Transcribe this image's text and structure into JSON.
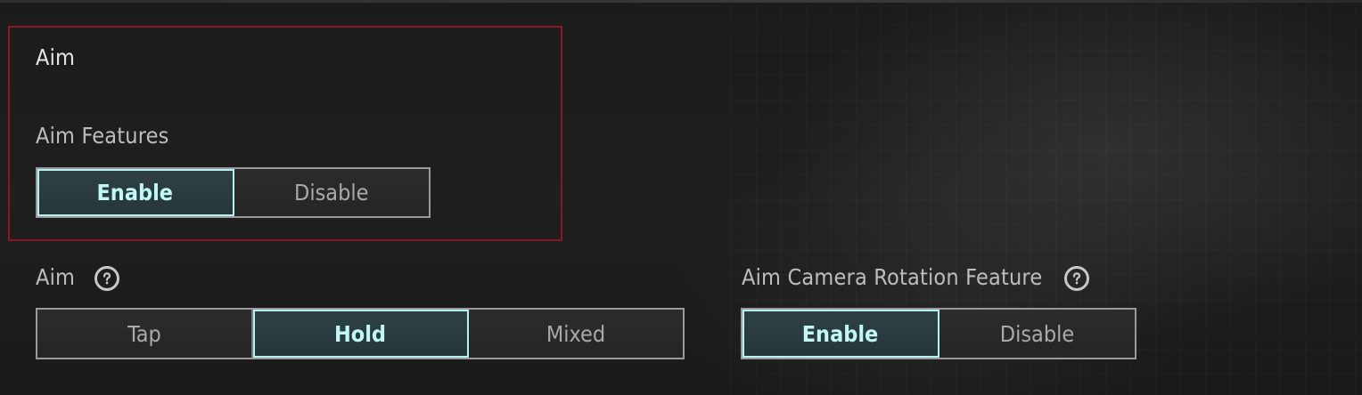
{
  "section": {
    "title": "Aim",
    "features_label": "Aim Features",
    "features_options": [
      "Enable",
      "Disable"
    ],
    "features_selected": "Enable"
  },
  "aim": {
    "label": "Aim",
    "options": [
      "Tap",
      "Hold",
      "Mixed"
    ],
    "selected": "Hold",
    "help_icon": "question-circle-icon"
  },
  "camera_rotation": {
    "label": "Aim Camera Rotation Feature",
    "options": [
      "Enable",
      "Disable"
    ],
    "selected": "Enable",
    "help_icon": "question-circle-icon"
  },
  "colors": {
    "highlight_border": "#8e1324",
    "active_text": "#bff8f4",
    "active_border": "#b8f2ef",
    "inactive_text": "#a9a9a9"
  }
}
